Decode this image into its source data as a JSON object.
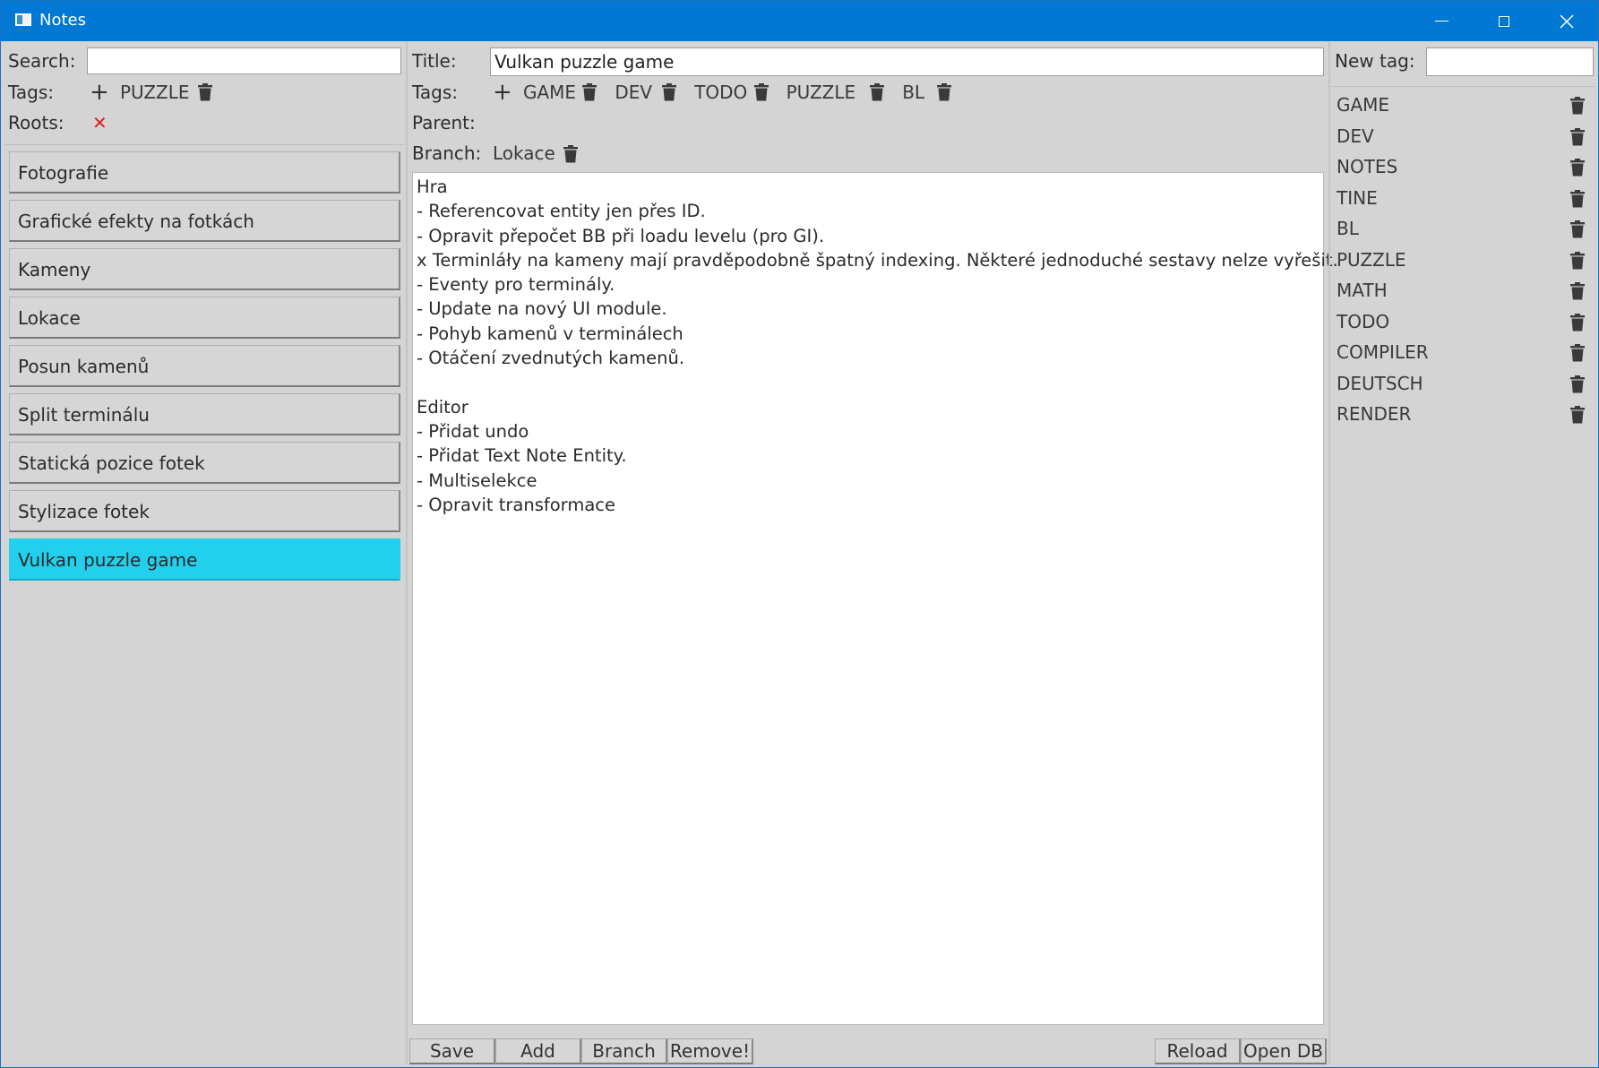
{
  "window": {
    "title": "Notes"
  },
  "search": {
    "label": "Search:",
    "value": ""
  },
  "filter_tags": {
    "label": "Tags:",
    "add": "+",
    "items": [
      "PUZZLE"
    ]
  },
  "roots": {
    "label": "Roots:",
    "clear": "✕"
  },
  "notes": [
    {
      "label": "Fotografie",
      "selected": false
    },
    {
      "label": "Grafické efekty na fotkách",
      "selected": false
    },
    {
      "label": "Kameny",
      "selected": false
    },
    {
      "label": "Lokace",
      "selected": false
    },
    {
      "label": "Posun kamenů",
      "selected": false
    },
    {
      "label": "Split terminálu",
      "selected": false
    },
    {
      "label": "Statická pozice fotek",
      "selected": false
    },
    {
      "label": "Stylizace fotek",
      "selected": false
    },
    {
      "label": "Vulkan puzzle game",
      "selected": true
    }
  ],
  "note": {
    "title_label": "Title:",
    "title": "Vulkan puzzle game",
    "tags_label": "Tags:",
    "add": "+",
    "tags": [
      "GAME",
      "DEV",
      "TODO",
      "PUZZLE",
      "BL"
    ],
    "parent_label": "Parent:",
    "parent": "",
    "branch_label": "Branch:",
    "branch": "Lokace",
    "body": "Hra\n- Referencovat entity jen přes ID.\n- Opravit přepočet BB při loadu levelu (pro GI).\nx Terminláły na kameny mají pravděpodobně špatný indexing. Některé jednoduché sestavy nelze vyřešit.\n- Eventy pro terminály.\n- Update na nový UI module.\n- Pohyb kamenů v terminálech\n- Otáčení zvednutých kamenů.\n\nEditor\n- Přidat undo\n- Přidat Text Note Entity.\n- Multiselekce\n- Opravit transformace"
  },
  "buttons": {
    "save": "Save",
    "add": "Add",
    "branch": "Branch",
    "remove": "Remove!",
    "reload": "Reload",
    "open_db": "Open DB"
  },
  "tag_panel": {
    "new_tag_label": "New tag:",
    "new_tag_value": "",
    "tags": [
      "GAME",
      "DEV",
      "NOTES",
      "TINE",
      "BL",
      "PUZZLE",
      "MATH",
      "TODO",
      "COMPILER",
      "DEUTSCH",
      "RENDER"
    ]
  },
  "colors": {
    "titlebar": "#0078d4",
    "selected": "#22cfec",
    "background": "#d4d4d4",
    "clear_x": "#e02020"
  },
  "icons": {
    "trash": "trash-icon",
    "plus": "plus-icon",
    "clear": "close-icon"
  }
}
